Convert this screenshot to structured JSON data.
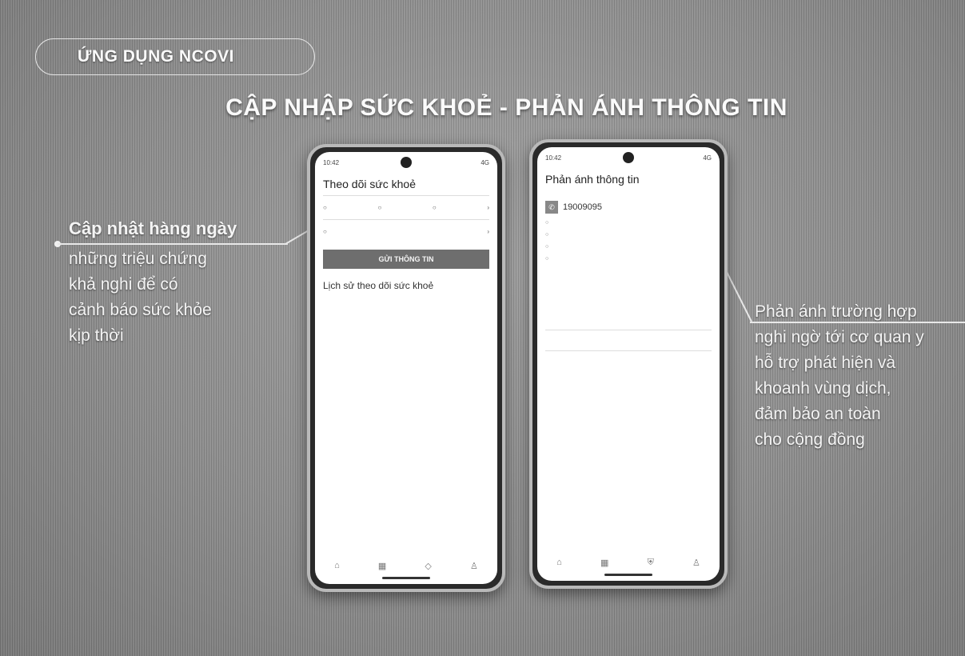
{
  "header": {
    "tag": "ỨNG DỤNG NCOVI",
    "title": "CẬP NHẬP SỨC KHOẺ - PHẢN ÁNH THÔNG TIN"
  },
  "left_callout": {
    "highlight": "Cập nhật hàng ngày",
    "lines": [
      "những triệu chứng",
      "khả nghi để có",
      "cảnh báo sức khỏe",
      "kịp thời"
    ]
  },
  "right_callout": {
    "lines": [
      "Phản ánh trường hợp",
      "nghi ngờ tới cơ quan y",
      "hỗ trợ phát hiện và",
      "khoanh vùng dịch,",
      "đảm bảo an toàn",
      "cho cộng đồng"
    ]
  },
  "phone_left": {
    "status_time": "10:42",
    "status_right": "4G",
    "screen_title": "Theo dõi sức khoẻ",
    "send_button": "GỬI THÔNG TIN",
    "history_title": "Lịch sử theo dõi sức khoẻ"
  },
  "phone_right": {
    "status_time": "10:42",
    "status_right": "4G",
    "screen_title": "Phản ánh thông tin",
    "hotline": "19009095"
  }
}
